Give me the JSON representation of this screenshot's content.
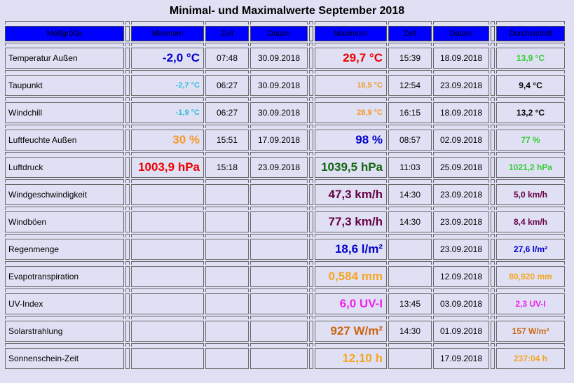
{
  "title": "Minimal- und Maximalwerte September 2018",
  "header": {
    "measure": "Meßgröße",
    "minimum": "Minimum",
    "time1": "Zeit",
    "date1": "Datum",
    "maximum": "Maximum",
    "time2": "Zeit",
    "date2": "Datum",
    "average": "Durchschnitt"
  },
  "colors": {
    "header_bg": "#0000ff",
    "page_bg": "#e0e0f4",
    "blue": "#0000cc",
    "red": "#ee0000",
    "green": "#33cc33",
    "cyan": "#33bbdd",
    "orange": "#f59a28",
    "darkgreen": "#116611",
    "purple": "#660044",
    "gold": "#f5a623",
    "magenta": "#ee22ee",
    "brown": "#cc6611"
  },
  "rows": [
    {
      "label": "Temperatur Außen",
      "min": "-2,0 °C",
      "min_time": "07:48",
      "min_date": "30.09.2018",
      "max": "29,7 °C",
      "max_time": "15:39",
      "max_date": "18.09.2018",
      "avg": "13,9 °C"
    },
    {
      "label": "Taupunkt",
      "min": "-2,7 °C",
      "min_time": "06:27",
      "min_date": "30.09.2018",
      "max": "18,5 °C",
      "max_time": "12:54",
      "max_date": "23.09.2018",
      "avg": "9,4 °C"
    },
    {
      "label": "Windchill",
      "min": "-1,9 °C",
      "min_time": "06:27",
      "min_date": "30.09.2018",
      "max": "28,9 °C",
      "max_time": "16:15",
      "max_date": "18.09.2018",
      "avg": "13,2 °C"
    },
    {
      "label": "Luftfeuchte Außen",
      "min": "30 %",
      "min_time": "15:51",
      "min_date": "17.09.2018",
      "max": "98 %",
      "max_time": "08:57",
      "max_date": "02.09.2018",
      "avg": "77 %"
    },
    {
      "label": "Luftdruck",
      "min": "1003,9 hPa",
      "min_time": "15:18",
      "min_date": "23.09.2018",
      "max": "1039,5 hPa",
      "max_time": "11:03",
      "max_date": "25.09.2018",
      "avg": "1021,2 hPa"
    },
    {
      "label": "Windgeschwindigkeit",
      "min": "",
      "min_time": "",
      "min_date": "",
      "max": "47,3 km/h",
      "max_time": "14:30",
      "max_date": "23.09.2018",
      "avg": "5,0 km/h"
    },
    {
      "label": "Windböen",
      "min": "",
      "min_time": "",
      "min_date": "",
      "max": "77,3 km/h",
      "max_time": "14:30",
      "max_date": "23.09.2018",
      "avg": "8,4 km/h"
    },
    {
      "label": "Regenmenge",
      "min": "",
      "min_time": "",
      "min_date": "",
      "max": "18,6 l/m²",
      "max_time": "",
      "max_date": "23.09.2018",
      "avg": "27,6 l/m²"
    },
    {
      "label": "Evapotranspiration",
      "min": "",
      "min_time": "",
      "min_date": "",
      "max": "0,584 mm",
      "max_time": "",
      "max_date": "12.09.2018",
      "avg": "80,920 mm"
    },
    {
      "label": "UV-Index",
      "min": "",
      "min_time": "",
      "min_date": "",
      "max": "6,0 UV-I",
      "max_time": "13:45",
      "max_date": "03.09.2018",
      "avg": "2,3 UV-I"
    },
    {
      "label": "Solarstrahlung",
      "min": "",
      "min_time": "",
      "min_date": "",
      "max": "927 W/m²",
      "max_time": "14:30",
      "max_date": "01.09.2018",
      "avg": "157 W/m²"
    },
    {
      "label": "Sonnenschein-Zeit",
      "min": "",
      "min_time": "",
      "min_date": "",
      "max": "12,10 h",
      "max_time": "",
      "max_date": "17.09.2018",
      "avg": "237:04 h"
    }
  ]
}
